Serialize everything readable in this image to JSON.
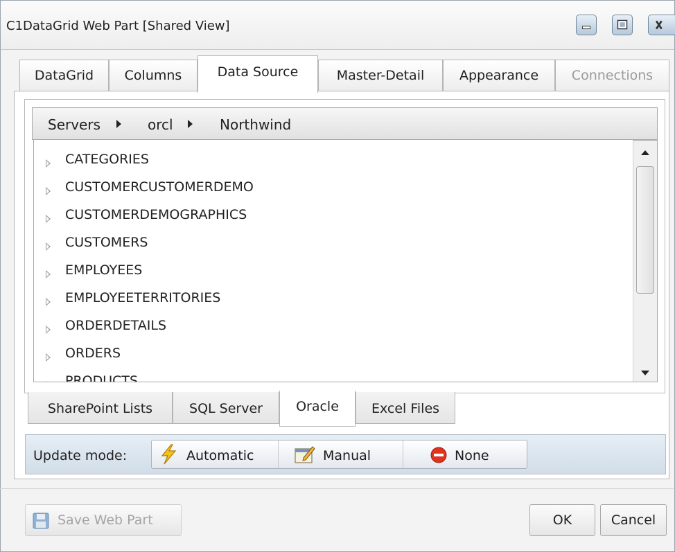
{
  "window": {
    "title": "C1DataGrid Web Part [Shared View]"
  },
  "tabs": [
    {
      "label": "DataGrid",
      "state": "normal"
    },
    {
      "label": "Columns",
      "state": "normal"
    },
    {
      "label": "Data Source",
      "state": "active"
    },
    {
      "label": "Master-Detail",
      "state": "normal"
    },
    {
      "label": "Appearance",
      "state": "normal"
    },
    {
      "label": "Connections",
      "state": "disabled"
    }
  ],
  "breadcrumb": {
    "items": [
      "Servers",
      "orcl",
      "Northwind"
    ]
  },
  "tables": [
    "CATEGORIES",
    "CUSTOMERCUSTOMERDEMO",
    "CUSTOMERDEMOGRAPHICS",
    "CUSTOMERS",
    "EMPLOYEES",
    "EMPLOYEETERRITORIES",
    "ORDERDETAILS",
    "ORDERS",
    "PRODUCTS"
  ],
  "source_tabs": [
    {
      "label": "SharePoint Lists",
      "state": "normal"
    },
    {
      "label": "SQL Server",
      "state": "normal"
    },
    {
      "label": "Oracle",
      "state": "active"
    },
    {
      "label": "Excel Files",
      "state": "normal"
    }
  ],
  "update_mode": {
    "label": "Update mode:",
    "options": [
      {
        "label": "Automatic",
        "icon": "lightning-icon"
      },
      {
        "label": "Manual",
        "icon": "manual-edit-icon"
      },
      {
        "label": "None",
        "icon": "stop-icon"
      }
    ]
  },
  "footer": {
    "save_label": "Save Web Part",
    "ok_label": "OK",
    "cancel_label": "Cancel"
  },
  "colors": {
    "accent_blue": "#3b78b8",
    "stop_red": "#e0321e",
    "lightning_yellow": "#f4c21c"
  }
}
